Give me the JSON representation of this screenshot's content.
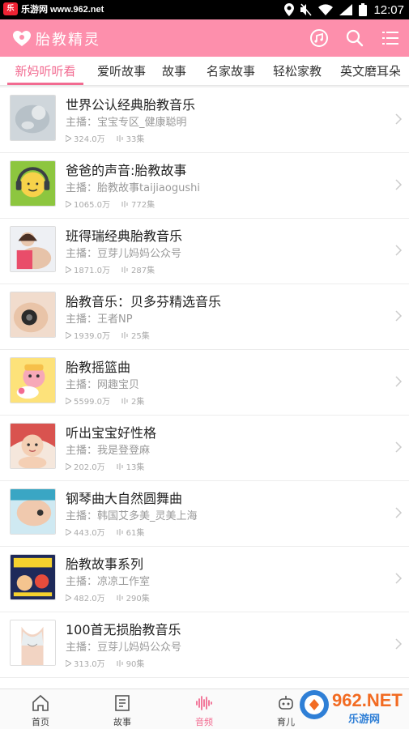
{
  "status_bar": {
    "site": "乐游网 www.962.net",
    "logo_text": "乐",
    "time": "12:07"
  },
  "app_bar": {
    "title": "胎教精灵"
  },
  "tabs": [
    {
      "label": "新妈听听看",
      "active": true
    },
    {
      "label": "爱听故事",
      "active": false
    },
    {
      "label": "故事",
      "active": false
    },
    {
      "label": "名家故事",
      "active": false
    },
    {
      "label": "轻松家教",
      "active": false
    },
    {
      "label": "英文磨耳朵",
      "active": false
    }
  ],
  "host_prefix": "主播：",
  "items": [
    {
      "title": "世界公认经典胎教音乐",
      "host": "宝宝专区_健康聪明",
      "plays": "324.0万",
      "episodes": "33集"
    },
    {
      "title": "爸爸的声音:胎教故事",
      "host": "胎教故事taijiaogushi",
      "plays": "1065.0万",
      "episodes": "772集"
    },
    {
      "title": "班得瑞经典胎教音乐",
      "host": "豆芽儿妈妈公众号",
      "plays": "1871.0万",
      "episodes": "287集"
    },
    {
      "title": "胎教音乐：贝多芬精选音乐",
      "host": "王者NP",
      "plays": "1939.0万",
      "episodes": "25集"
    },
    {
      "title": "胎教摇篮曲",
      "host": "网趣宝贝",
      "plays": "5599.0万",
      "episodes": "2集"
    },
    {
      "title": "听出宝宝好性格",
      "host": "我是登登麻",
      "plays": "202.0万",
      "episodes": "13集"
    },
    {
      "title": "钢琴曲大自然圆舞曲",
      "host": "韩国艾多美_灵美上海",
      "plays": "443.0万",
      "episodes": "61集"
    },
    {
      "title": "胎教故事系列",
      "host": "凉凉工作室",
      "plays": "482.0万",
      "episodes": "290集"
    },
    {
      "title": "100首无损胎教音乐",
      "host": "豆芽儿妈妈公众号",
      "plays": "313.0万",
      "episodes": "90集"
    }
  ],
  "bottom_nav": [
    {
      "label": "首页",
      "icon": "home-icon",
      "active": false
    },
    {
      "label": "故事",
      "icon": "book-icon",
      "active": false
    },
    {
      "label": "音频",
      "icon": "audio-wave-icon",
      "active": true
    },
    {
      "label": "育儿",
      "icon": "robot-icon",
      "active": false
    }
  ],
  "watermark": {
    "brand": "962.NET",
    "sub": "乐游网"
  },
  "colors": {
    "accent": "#f26b91",
    "app_bar": "#fd8fac",
    "muted_text": "#9a9a9a"
  }
}
